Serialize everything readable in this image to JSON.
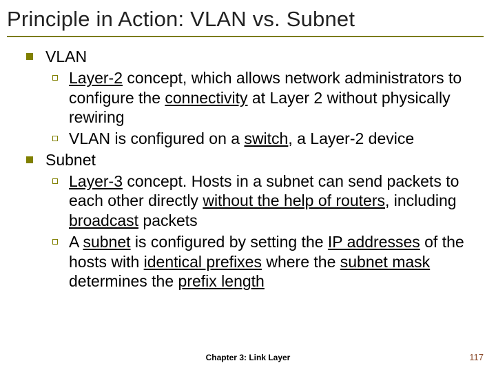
{
  "title": "Principle in Action: VLAN vs. Subnet",
  "items": [
    {
      "label": "VLAN",
      "subs": [
        {
          "segments": [
            {
              "u": true,
              "t": "Layer-2"
            },
            {
              "u": false,
              "t": " concept, which allows network administrators to configure the "
            },
            {
              "u": true,
              "t": "connectivity"
            },
            {
              "u": false,
              "t": " at Layer 2 without physically rewiring"
            }
          ]
        },
        {
          "segments": [
            {
              "u": false,
              "t": "VLAN is configured on a "
            },
            {
              "u": true,
              "t": "switch"
            },
            {
              "u": false,
              "t": ", a Layer-2 device"
            }
          ]
        }
      ]
    },
    {
      "label": "Subnet",
      "subs": [
        {
          "segments": [
            {
              "u": true,
              "t": "Layer-3"
            },
            {
              "u": false,
              "t": " concept. Hosts in a subnet can send packets to each other directly "
            },
            {
              "u": true,
              "t": "without the help of routers"
            },
            {
              "u": false,
              "t": ", including "
            },
            {
              "u": true,
              "t": "broadcast"
            },
            {
              "u": false,
              "t": " packets"
            }
          ]
        },
        {
          "segments": [
            {
              "u": false,
              "t": "A "
            },
            {
              "u": true,
              "t": "subnet"
            },
            {
              "u": false,
              "t": " is configured by setting the "
            },
            {
              "u": true,
              "t": "IP addresses"
            },
            {
              "u": false,
              "t": " of the hosts with "
            },
            {
              "u": true,
              "t": "identical prefixes"
            },
            {
              "u": false,
              "t": " where the "
            },
            {
              "u": true,
              "t": "subnet mask"
            },
            {
              "u": false,
              "t": " determines the "
            },
            {
              "u": true,
              "t": "prefix length"
            }
          ]
        }
      ]
    }
  ],
  "footer": {
    "center": "Chapter 3: Link Layer",
    "page": "117"
  }
}
